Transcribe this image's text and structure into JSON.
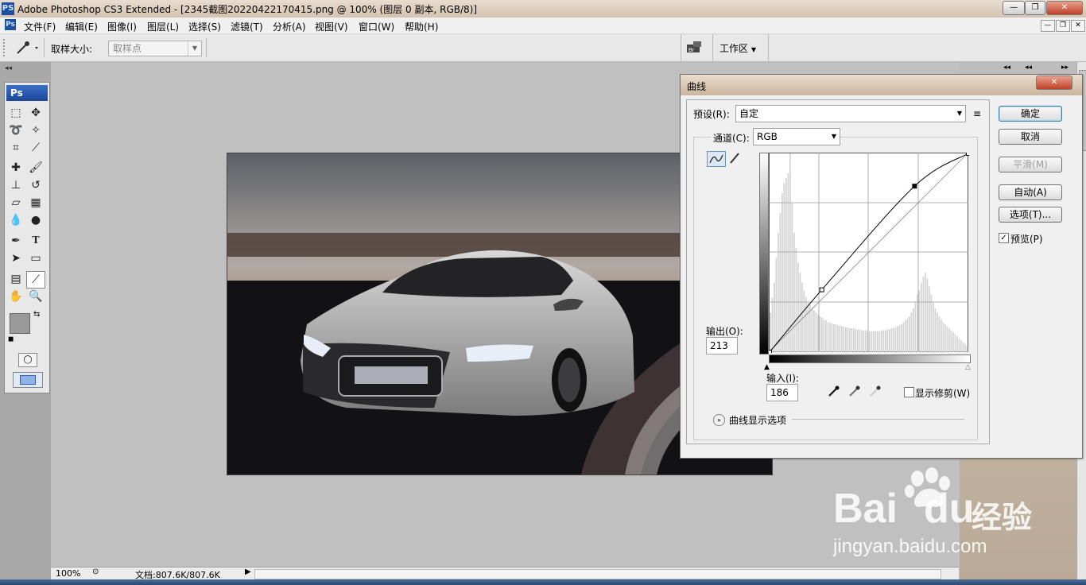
{
  "titlebar": {
    "app_icon": "PS",
    "title": "Adobe Photoshop CS3 Extended - [2345截图20220422170415.png @ 100% (图层 0 副本, RGB/8)]",
    "minimize": "—",
    "maximize": "❐",
    "close": "✕"
  },
  "menubar": {
    "icon": "Ps",
    "items": [
      "文件(F)",
      "编辑(E)",
      "图像(I)",
      "图层(L)",
      "选择(S)",
      "滤镜(T)",
      "分析(A)",
      "视图(V)",
      "窗口(W)",
      "帮助(H)"
    ],
    "doc_minimize": "—",
    "doc_restore": "❐",
    "doc_close": "✕"
  },
  "options": {
    "sample_size_label": "取样大小:",
    "sample_size_value": "取样点",
    "workspace_label": "工作区"
  },
  "toolbox": {
    "logo": "Ps"
  },
  "status": {
    "zoom": "100%",
    "doc_info": "文档:807.6K/807.6K"
  },
  "curves": {
    "title": "曲线",
    "preset_label": "预设(R):",
    "preset_value": "自定",
    "channel_label": "通道(C):",
    "channel_value": "RGB",
    "output_label": "输出(O):",
    "output_value": "213",
    "input_label": "输入(I):",
    "input_value": "186",
    "show_clipping_label": "显示修剪(W)",
    "show_clipping_checked": false,
    "display_options_label": "曲线显示选项",
    "buttons": {
      "ok": "确定",
      "cancel": "取消",
      "smooth": "平滑(M)",
      "auto": "自动(A)",
      "options": "选项(T)..."
    },
    "preview_label": "预览(P)",
    "preview_checked": true,
    "curve_points": [
      [
        0,
        0
      ],
      [
        67,
        80
      ],
      [
        186,
        213
      ],
      [
        255,
        255
      ]
    ],
    "histogram": [
      40,
      55,
      70,
      95,
      120,
      140,
      160,
      170,
      175,
      180,
      200,
      150,
      120,
      105,
      90,
      80,
      70,
      62,
      55,
      50,
      48,
      45,
      42,
      40,
      38,
      36,
      35,
      33,
      32,
      30,
      30,
      29,
      28,
      28,
      27,
      27,
      26,
      26,
      25,
      25,
      24,
      24,
      24,
      23,
      23,
      23,
      22,
      22,
      22,
      22,
      21,
      21,
      21,
      21,
      21,
      21,
      22,
      22,
      22,
      23,
      23,
      24,
      24,
      25,
      26,
      27,
      28,
      30,
      32,
      34,
      36,
      40,
      44,
      50,
      58,
      62,
      70,
      76,
      80,
      74,
      66,
      58,
      50,
      44,
      40,
      36,
      33,
      30,
      28,
      26,
      24,
      22,
      20,
      18,
      16,
      14,
      12,
      10,
      8,
      6
    ]
  },
  "watermark": {
    "brand": "Bai",
    "brand2": "du",
    "cn": "经验",
    "url": "jingyan.baidu.com"
  }
}
